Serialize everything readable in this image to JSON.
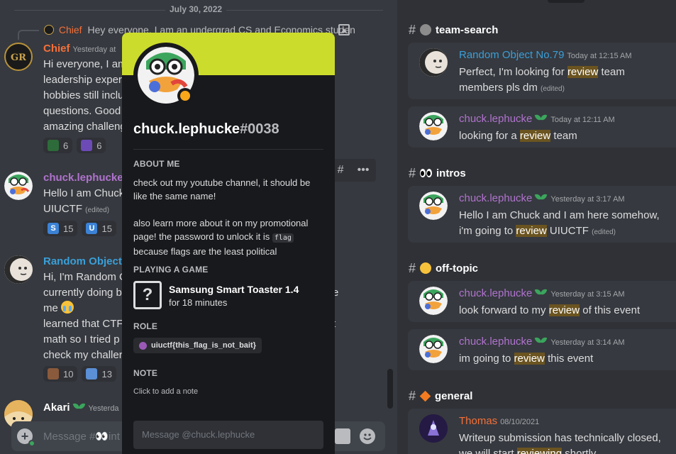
{
  "chat": {
    "date_divider": "July 30, 2022",
    "reply": {
      "author": "Chief",
      "text": "Hey everyone, I am an undergrad CS and Economics studen"
    },
    "messages": [
      {
        "author": "Chief",
        "author_color": "#f4703a",
        "time": "Yesterday at",
        "lines": [
          "Hi everyone, I am",
          "leadership exper",
          "hobbies still inclu",
          "questions. Good",
          "amazing challeng"
        ],
        "reactions": [
          {
            "icon": "snake-emoji",
            "count": "6"
          },
          {
            "icon": "purple-emoji",
            "count": "6"
          }
        ]
      },
      {
        "author": "chuck.lephucke",
        "author_color": "#b073ce",
        "lines": [
          "Hello I am Chuck",
          "UIUCTF"
        ],
        "edited": "(edited)",
        "reactions": [
          {
            "icon": "S",
            "count": "15"
          },
          {
            "icon": "U",
            "count": "15"
          }
        ]
      },
      {
        "author": "Random Object N",
        "author_color": "#3a9fd8",
        "lines": [
          "Hi, I'm Random O",
          "currently doing b",
          "me",
          "learned that CTF",
          "math so I tried p",
          "check my challer"
        ],
        "side_fragments": [
          "e",
          "t"
        ],
        "reactions": [
          {
            "icon": "person-emoji",
            "count": "10"
          },
          {
            "icon": "robot-emoji",
            "count": "13"
          }
        ]
      },
      {
        "author": "Akari",
        "author_color": "#ffffff",
        "time": "Yesterda"
      }
    ],
    "message_box_placeholder": "Message #👀int"
  },
  "profile": {
    "username": "chuck.lephucke",
    "discriminator": "#0038",
    "about_heading": "ABOUT ME",
    "about_line1": "check out my youtube channel, it should be like the same name!",
    "about_line2a": "also learn more about it on my promotional page!",
    "about_line2b": "the password to unlock it is",
    "about_code": "flag",
    "about_line2c": "because flags are the least political",
    "game_heading": "PLAYING A GAME",
    "game_name": "Samsung Smart Toaster 1.4",
    "game_time": "for 18 minutes",
    "role_heading": "ROLE",
    "role_name": "uiuctf{this_flag_is_not_bait}",
    "note_heading": "NOTE",
    "note_placeholder": "Click to add a note",
    "message_placeholder": "Message @chuck.lephucke"
  },
  "search": {
    "groups": [
      {
        "channel": "team-search",
        "emoji": "binoculars-emoji",
        "results": [
          {
            "author": "Random Object No.79",
            "author_color": "#3a9fd8",
            "time": "Today at 12:15 AM",
            "pre": "Perfect, I'm looking for ",
            "hl": "review",
            "post": " team members pls dm",
            "edited": "(edited)"
          },
          {
            "author": "chuck.lephucke",
            "author_color": "#b073ce",
            "time": "Today at 12:11 AM",
            "pre": "looking for a ",
            "hl": "review",
            "post": " team"
          }
        ]
      },
      {
        "channel": "intros",
        "emoji": "eyes-emoji",
        "results": [
          {
            "author": "chuck.lephucke",
            "author_color": "#b073ce",
            "time": "Yesterday at 3:17 AM",
            "pre": "Hello I am Chuck and I am here somehow, i'm going to ",
            "hl": "review",
            "post": " UIUCTF",
            "edited": "(edited)"
          }
        ]
      },
      {
        "channel": "off-topic",
        "emoji": "party-emoji",
        "results": [
          {
            "author": "chuck.lephucke",
            "author_color": "#b073ce",
            "time": "Yesterday at 3:15 AM",
            "pre": "look forward to my ",
            "hl": "review",
            "post": " of this event"
          },
          {
            "author": "chuck.lephucke",
            "author_color": "#b073ce",
            "time": "Yesterday at 3:14 AM",
            "pre": "im going to ",
            "hl": "review",
            "post": " this event"
          }
        ]
      },
      {
        "channel": "general",
        "emoji": "orange-diamond-emoji",
        "results": [
          {
            "author": "Thomas",
            "author_color": "#f4703a",
            "time": "08/10/2021",
            "pre": "Writeup submission has technically closed, we will start ",
            "hl": "reviewing",
            "post": " shortly"
          }
        ]
      }
    ]
  },
  "colors": {
    "chat_bg": "#36393f",
    "panel_bg": "#2f3136",
    "popout_bg": "#18191c",
    "banner": "#ccdc2c",
    "highlight": "#6b5420"
  }
}
